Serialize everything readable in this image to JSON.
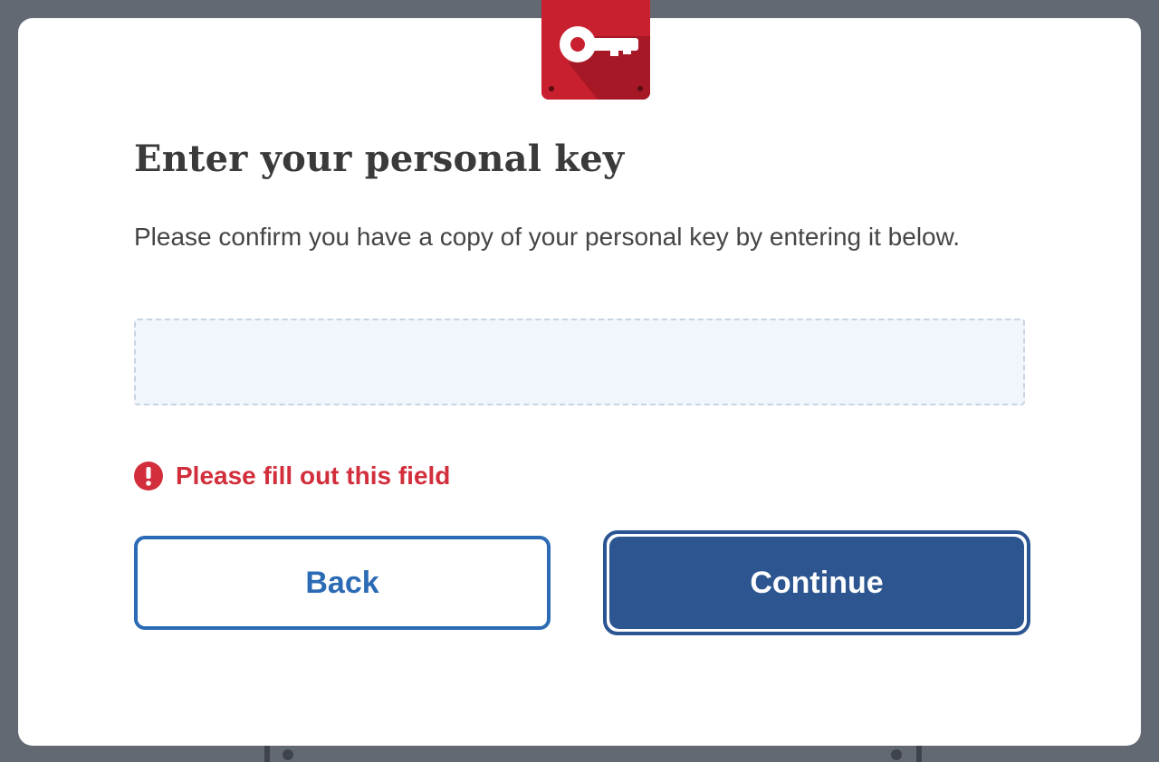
{
  "dialog": {
    "title": "Enter your personal key",
    "description": "Please confirm you have a copy of your personal key by entering it below.",
    "badge_icon": "key-icon",
    "badge_color": "#c8202f"
  },
  "personal_key_input": {
    "value": "",
    "placeholder": ""
  },
  "validation": {
    "icon": "error-exclamation-icon",
    "message": "Please fill out this field",
    "color": "#d22e3c"
  },
  "actions": {
    "back_label": "Back",
    "continue_label": "Continue",
    "primary_color": "#2d5690",
    "secondary_color": "#2b6bb5"
  }
}
